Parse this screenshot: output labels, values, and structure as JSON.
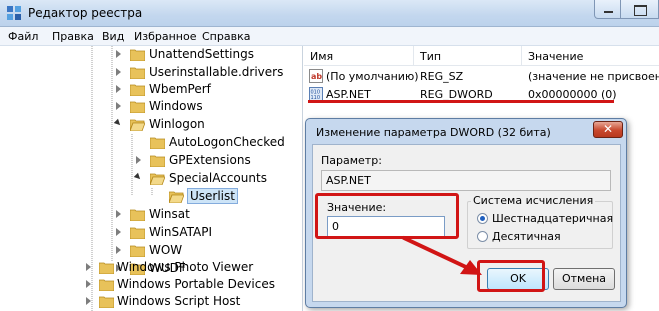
{
  "window": {
    "title": "Редактор реестра"
  },
  "menu": [
    "Файл",
    "Правка",
    "Вид",
    "Избранное",
    "Справка"
  ],
  "tree": {
    "items": [
      {
        "label": "UnattendSettings",
        "state": "collapsed"
      },
      {
        "label": "Userinstallable.drivers",
        "state": "collapsed"
      },
      {
        "label": "WbemPerf",
        "state": "collapsed"
      },
      {
        "label": "Windows",
        "state": "collapsed"
      },
      {
        "label": "Winlogon",
        "state": "expanded"
      },
      {
        "label": "AutoLogonChecked",
        "state": "none"
      },
      {
        "label": "GPExtensions",
        "state": "collapsed"
      },
      {
        "label": "SpecialAccounts",
        "state": "expanded"
      },
      {
        "label": "Userlist",
        "state": "selected"
      },
      {
        "label": "Winsat",
        "state": "collapsed"
      },
      {
        "label": "WinSATAPI",
        "state": "collapsed"
      },
      {
        "label": "WOW",
        "state": "collapsed"
      },
      {
        "label": "WUDF",
        "state": "collapsed"
      },
      {
        "label": "Windows Photo Viewer",
        "state": "collapsed"
      },
      {
        "label": "Windows Portable Devices",
        "state": "collapsed"
      },
      {
        "label": "Windows Script Host",
        "state": "collapsed"
      }
    ]
  },
  "list": {
    "columns": [
      "Имя",
      "Тип",
      "Значение"
    ],
    "rows": [
      {
        "name": "(По умолчанию)",
        "type": "REG_SZ",
        "value": "(значение не присвоено)",
        "icon": "string-value-icon"
      },
      {
        "name": "ASP.NET",
        "type": "REG_DWORD",
        "value": "0x00000000 (0)",
        "icon": "dword-value-icon"
      }
    ]
  },
  "dialog": {
    "title": "Изменение параметра DWORD (32 бита)",
    "close_label": "✕",
    "param_label": "Параметр:",
    "param_value": "ASP.NET",
    "value_label": "Значение:",
    "value": "0",
    "base_group_label": "Система исчисления",
    "base_options": [
      "Шестнадцатеричная",
      "Десятичная"
    ],
    "base_selected": "Шестнадцатеричная",
    "ok_label": "OK",
    "cancel_label": "Отмена"
  },
  "colors": {
    "annotation_red": "#d11515",
    "folder_yellow": "#e8c25a"
  }
}
